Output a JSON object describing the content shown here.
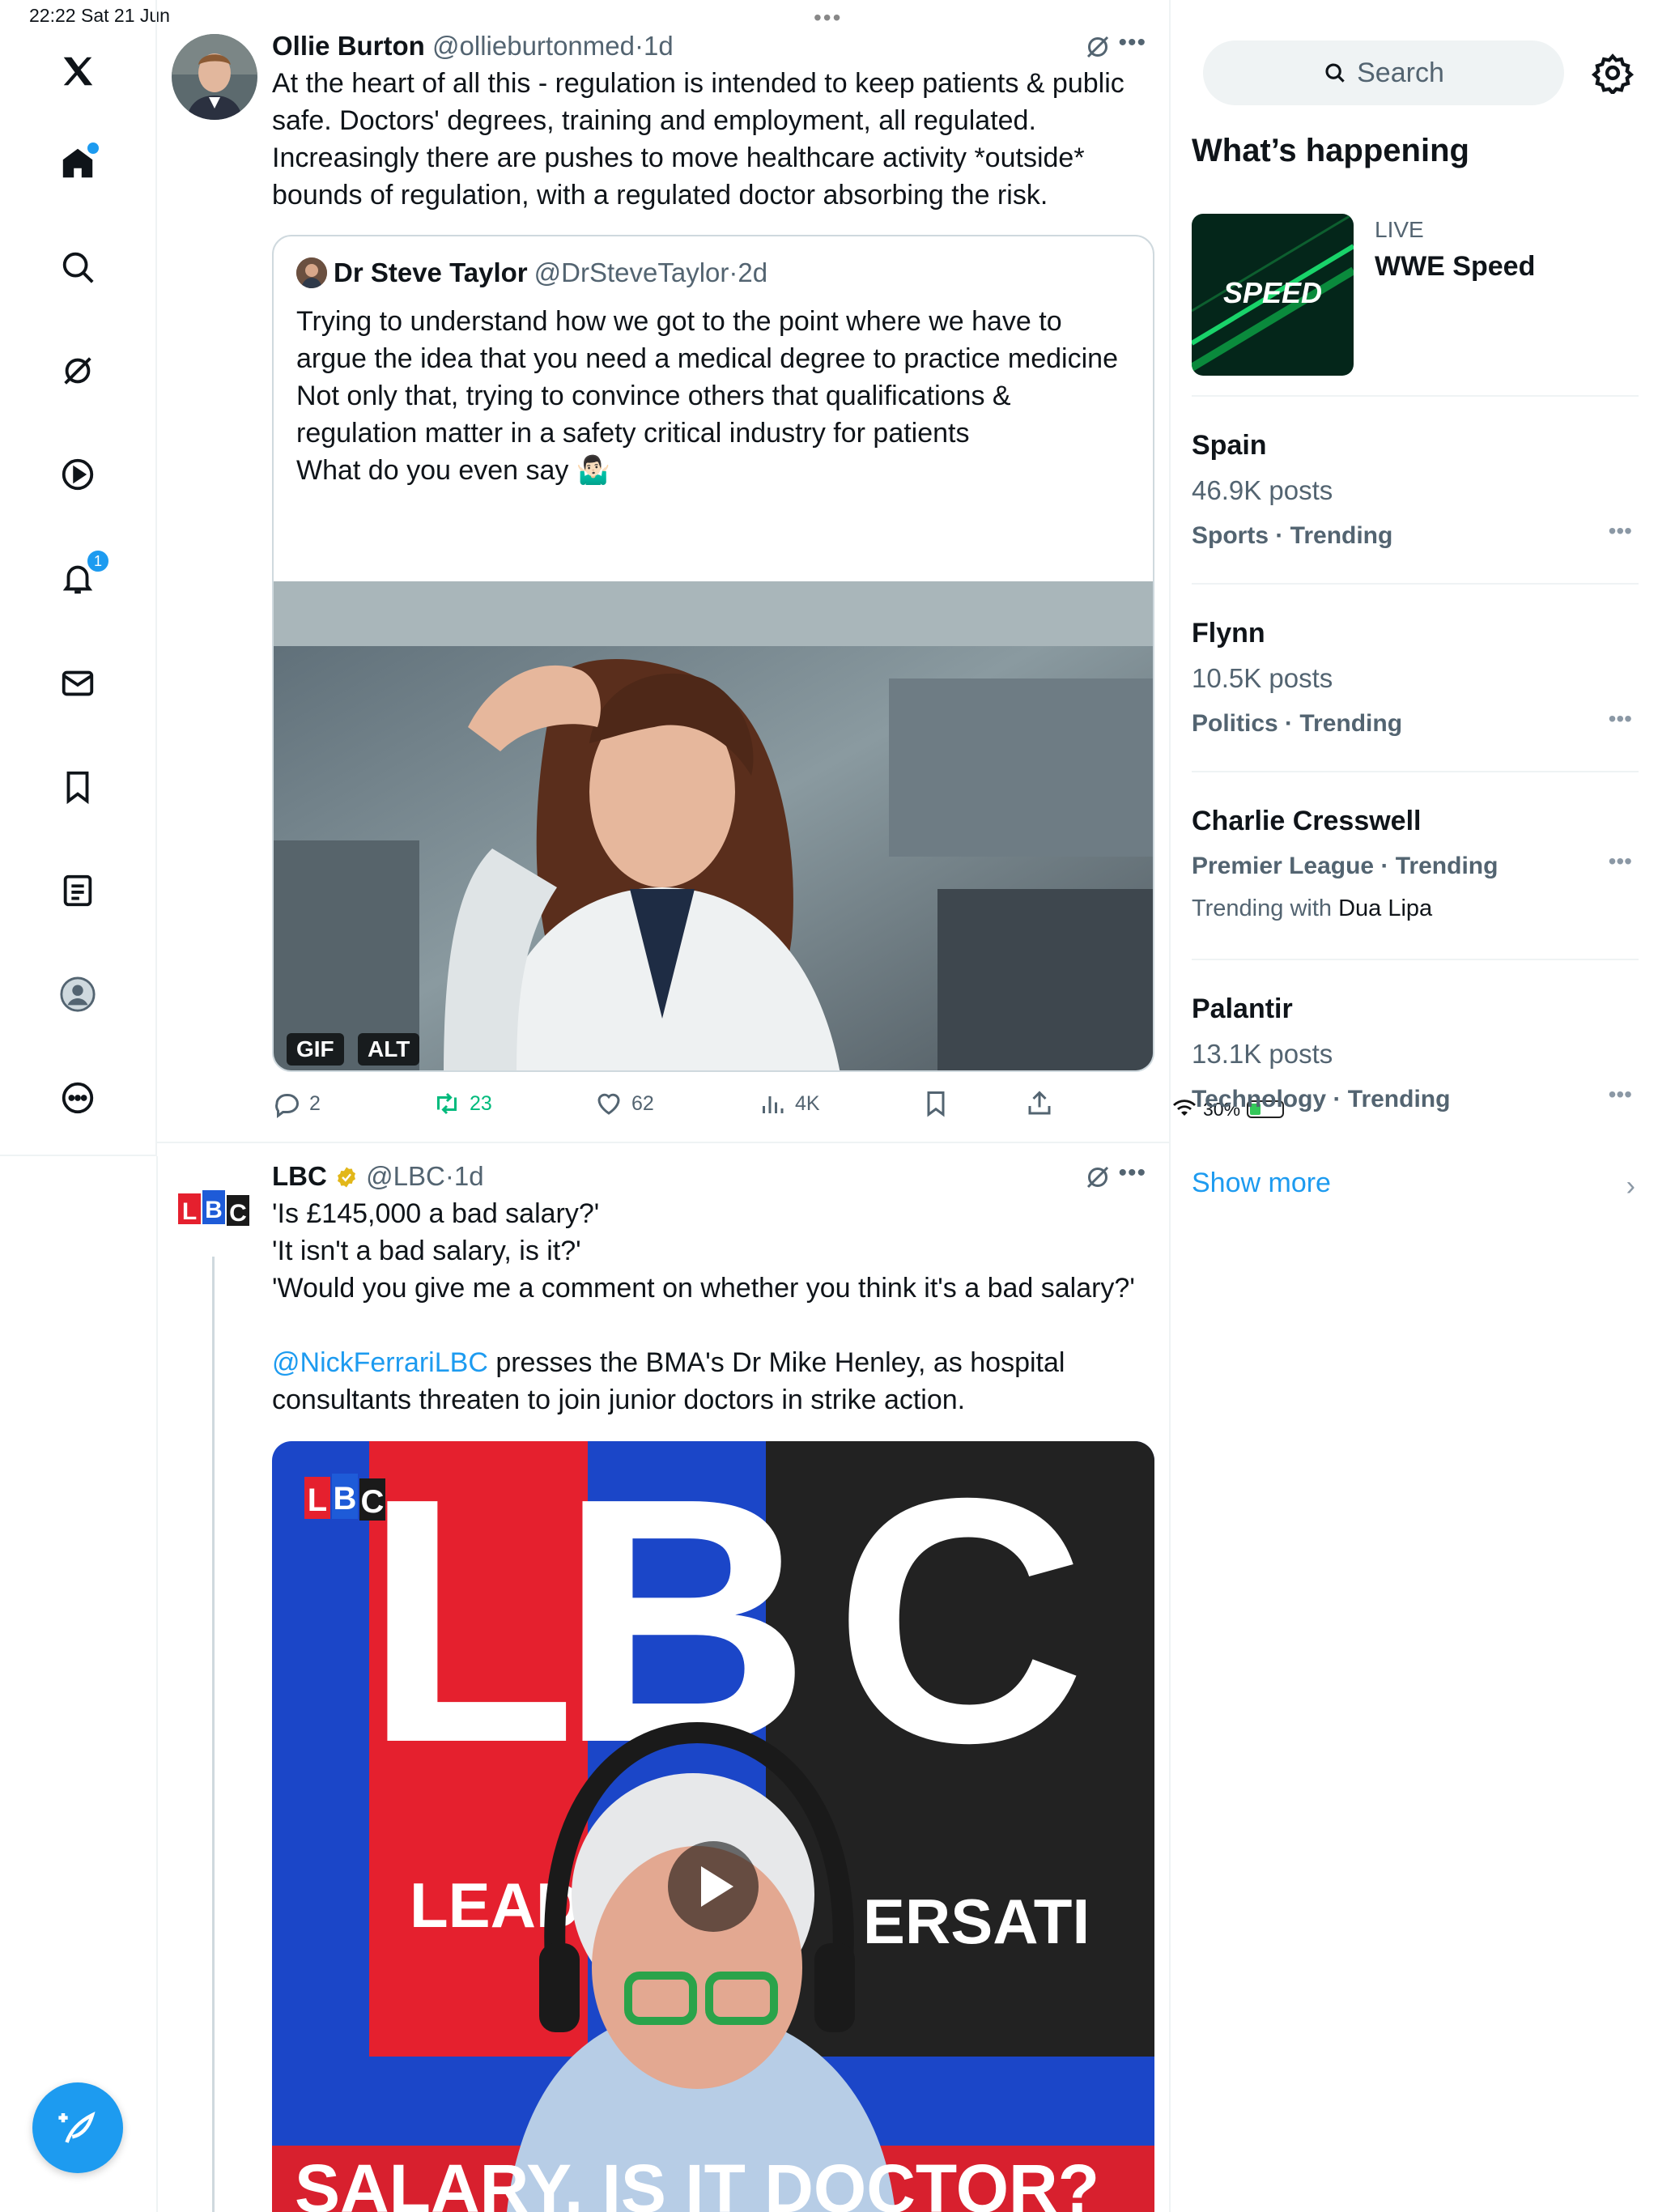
{
  "status": {
    "time": "22:22",
    "date": "Sat 21 Jun",
    "battery": "30%"
  },
  "sidebar": {
    "items": [
      {
        "name": "home",
        "icon": "home-icon",
        "active": true
      },
      {
        "name": "explore",
        "icon": "search-icon"
      },
      {
        "name": "grok",
        "icon": "grok-icon"
      },
      {
        "name": "video",
        "icon": "play-icon"
      },
      {
        "name": "notifications",
        "icon": "bell-icon",
        "badge": "1"
      },
      {
        "name": "messages",
        "icon": "mail-icon"
      },
      {
        "name": "bookmarks",
        "icon": "bookmark-icon"
      },
      {
        "name": "lists",
        "icon": "list-icon"
      },
      {
        "name": "profile",
        "icon": "profile-icon"
      },
      {
        "name": "more",
        "icon": "more-circle-icon"
      }
    ],
    "compose_icon": "compose-icon"
  },
  "tweets": [
    {
      "name": "Ollie Burton",
      "handle": "@ollieburtonmed",
      "sep": "·",
      "time": "1d",
      "text": "At the heart of all this - regulation is intended to keep patients & public safe. Doctors' degrees, training and employment, all regulated. Increasingly there are pushes to move healthcare activity *outside* bounds of regulation, with a regulated doctor absorbing the risk.",
      "quote": {
        "name": "Dr Steve Taylor",
        "handle": "@DrSteveTaylor",
        "sep": "·",
        "time": "2d",
        "line1": "Trying to understand how we got to the point where we have to argue the idea that you need a medical degree to practice medicine",
        "line2": "Not only that, trying to convince others that qualifications & regulation matter in a safety critical industry for patients",
        "line3": "What do you even say 🤷🏻‍♂️",
        "tag_gif": "GIF",
        "tag_alt": "ALT"
      },
      "actions": {
        "replies": "2",
        "reposts": "23",
        "likes": "62",
        "views": "4K"
      }
    },
    {
      "name": "LBC",
      "handle": "@LBC",
      "sep": "·",
      "time": "1d",
      "line1": "'Is £145,000 a bad salary?'",
      "line2": "'It isn't a bad salary, is it?'",
      "line3": "'Would you give me a comment on whether you think it's a bad salary?'",
      "mention": "@NickFerrariLBC",
      "line4": " presses the BMA's Dr Mike Henley, as hospital consultants threaten to join junior doctors in strike action.",
      "video": {
        "logo_l": "L",
        "logo_b": "B",
        "logo_c": "C",
        "big_letters": "LBC",
        "banner_left": "LEAD",
        "banner_right": "ERSATI",
        "caption": "SALARY, IS IT DOCTOR?"
      }
    }
  ],
  "right": {
    "search_placeholder": "Search",
    "section_title": "What’s happening",
    "live": {
      "label": "LIVE",
      "title": "WWE Speed",
      "thumb_text": "SPEED"
    },
    "trends": [
      {
        "name": "Spain",
        "posts": "46.9K posts",
        "category": "Sports · Trending"
      },
      {
        "name": "Flynn",
        "posts": "10.5K posts",
        "category": "Politics · Trending"
      },
      {
        "name": "Charlie Cresswell",
        "category": "Premier League · Trending",
        "with_prefix": "Trending with ",
        "with_name": "Dua Lipa"
      },
      {
        "name": "Palantir",
        "posts": "13.1K posts",
        "category": "Technology · Trending"
      }
    ],
    "show_more": "Show more"
  },
  "colors": {
    "accent": "#1d9bf0",
    "repost_green": "#00ba7c",
    "text": "#0f1419",
    "muted": "#536471"
  }
}
